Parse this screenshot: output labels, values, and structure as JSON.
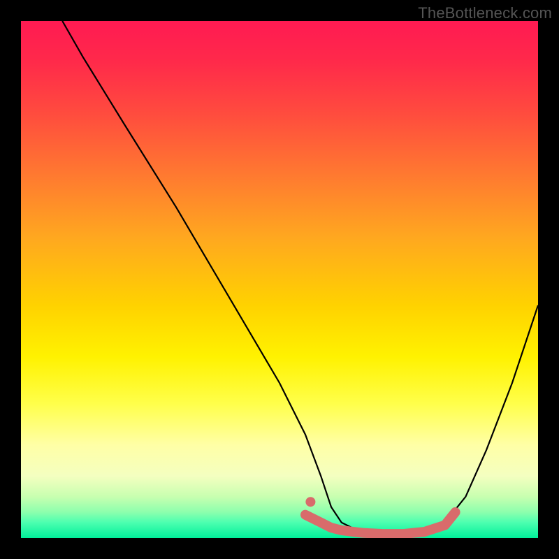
{
  "watermark": "TheBottleneck.com",
  "chart_data": {
    "type": "line",
    "title": "",
    "xlabel": "",
    "ylabel": "",
    "xlim": [
      0,
      100
    ],
    "ylim": [
      0,
      100
    ],
    "series": [
      {
        "name": "curve",
        "x": [
          8,
          12,
          20,
          30,
          40,
          50,
          55,
          58,
          60,
          62,
          66,
          70,
          74,
          78,
          82,
          86,
          90,
          95,
          100
        ],
        "values": [
          100,
          93,
          80,
          64,
          47,
          30,
          20,
          12,
          6,
          3,
          1,
          0.5,
          0.5,
          1,
          3,
          8,
          17,
          30,
          45
        ]
      }
    ],
    "highlight_region": {
      "name": "bottom-band",
      "x": [
        55,
        58,
        60,
        62,
        66,
        70,
        74,
        78,
        82,
        84
      ],
      "values": [
        4.5,
        3,
        2,
        1.5,
        1,
        0.8,
        0.8,
        1.2,
        2.5,
        5
      ]
    },
    "highlight_dot": {
      "x": 56,
      "y": 7
    },
    "colors": {
      "curve": "#000000",
      "highlight": "#d96b6b"
    }
  }
}
